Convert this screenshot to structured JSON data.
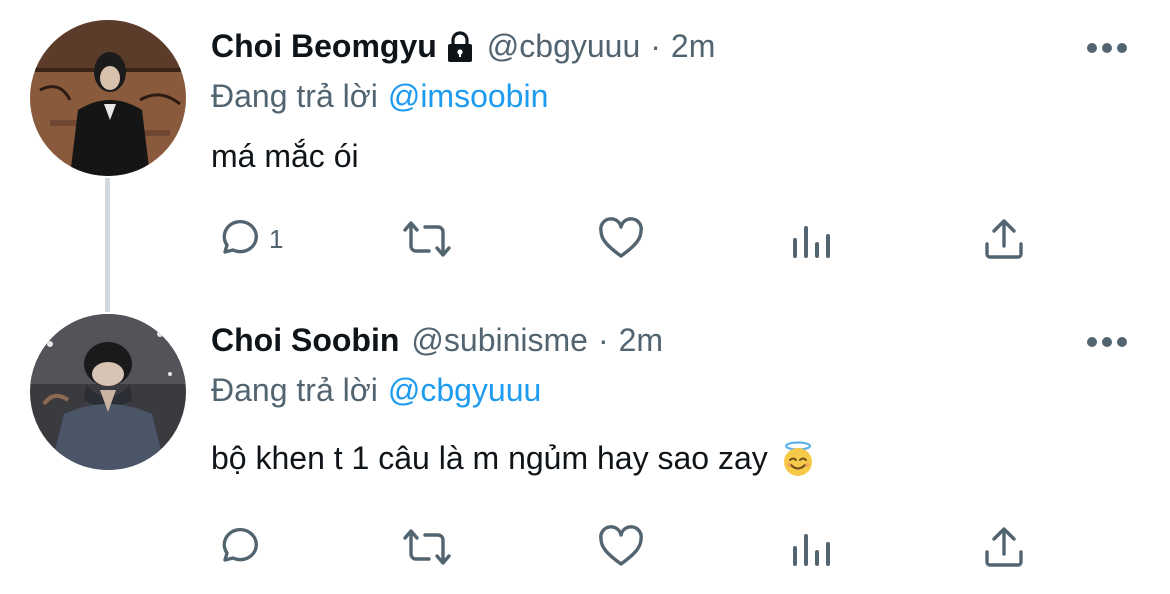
{
  "colors": {
    "text": "#0f1419",
    "secondary": "#536471",
    "accent": "#1d9bf0",
    "thread_line": "#cfd9de"
  },
  "tweets": [
    {
      "display_name": "Choi Beomgyu",
      "protected_icon": "lock-icon",
      "handle": "@cbgyuuu",
      "separator": "·",
      "time": "2m",
      "reply_prefix": "Đang trả lời",
      "reply_to": "@imsoobin",
      "text": "má mắc ói",
      "reply_count": "1",
      "icons": [
        "reply-icon",
        "retweet-icon",
        "like-icon",
        "stats-icon",
        "share-icon",
        "more-icon"
      ]
    },
    {
      "display_name": "Choi Soobin",
      "handle": "@subinisme",
      "separator": "·",
      "time": "2m",
      "reply_prefix": "Đang trả lời",
      "reply_to": "@cbgyuuu",
      "text": "bộ khen t 1 câu là m ngủm hay sao zay",
      "emoji": "smiling-face-with-halo",
      "reply_count": "",
      "icons": [
        "reply-icon",
        "retweet-icon",
        "like-icon",
        "stats-icon",
        "share-icon",
        "more-icon"
      ]
    }
  ]
}
